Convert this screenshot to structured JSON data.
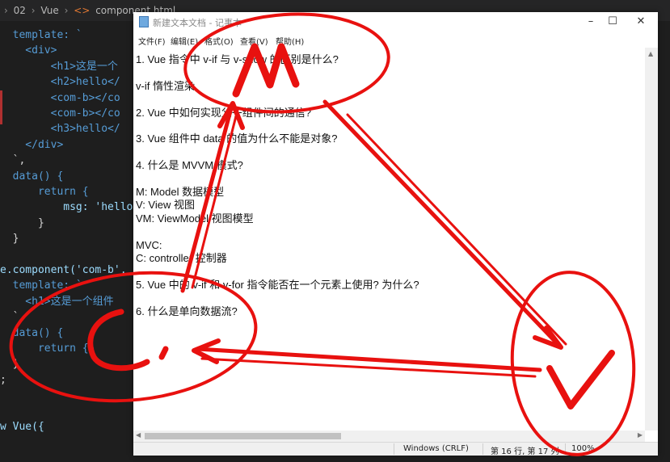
{
  "editor": {
    "breadcrumb": {
      "folder": "02",
      "section": "Vue",
      "file": "component.html"
    },
    "code_lines": [
      {
        "t": "  template: `"
      },
      {
        "t": "    <div>"
      },
      {
        "t": "        <h1>这是一个"
      },
      {
        "t": "        <h2>hello</"
      },
      {
        "t": "        <com-b></co"
      },
      {
        "t": "        <com-b></co"
      },
      {
        "t": "        <h3>hello</"
      },
      {
        "t": "    </div>"
      },
      {
        "t": "  `,"
      },
      {
        "t": "  data() {"
      },
      {
        "t": "      return {"
      },
      {
        "t": "          msg: 'hello"
      },
      {
        "t": "      }"
      },
      {
        "t": "  }"
      },
      {
        "t": ""
      },
      {
        "t": "e.component('com-b',"
      },
      {
        "t": "  template: `"
      },
      {
        "t": "    <h1>这是一个组件"
      },
      {
        "t": "  `,"
      },
      {
        "t": "  data() {"
      },
      {
        "t": "      return {}"
      },
      {
        "t": "  }"
      },
      {
        "t": ";"
      },
      {
        "t": ""
      },
      {
        "t": ""
      },
      {
        "t": "w Vue({"
      }
    ]
  },
  "notepad": {
    "title": "新建文本文档 - 记事本",
    "menu": {
      "file": "文件(F)",
      "edit": "编辑(E)",
      "format": "格式(O)",
      "view": "查看(V)",
      "help": "帮助(H)"
    },
    "lines": [
      "1. Vue 指令中 v-if 与 v-show 的区别是什么?",
      "",
      "v-if 惰性渲染",
      "",
      "2. Vue 中如何实现父子组件间的通信?",
      "",
      "3. Vue 组件中 data 的值为什么不能是对象?",
      "",
      "4. 什么是 MVVM 模式?",
      "",
      "M: Model 数据模型",
      "V: View 视图",
      "VM: ViewModel 视图模型",
      "",
      "MVC:",
      "C: controller 控制器",
      "",
      "5. Vue 中的 v-if 和 v-for 指令能否在一个元素上使用? 为什么?",
      "",
      "6. 什么是单向数据流?"
    ],
    "status": {
      "encoding": "Windows (CRLF)",
      "position": "第 16 行, 第 17 列",
      "zoom": "100%"
    }
  },
  "annotations": {
    "color": "#e8110f"
  }
}
